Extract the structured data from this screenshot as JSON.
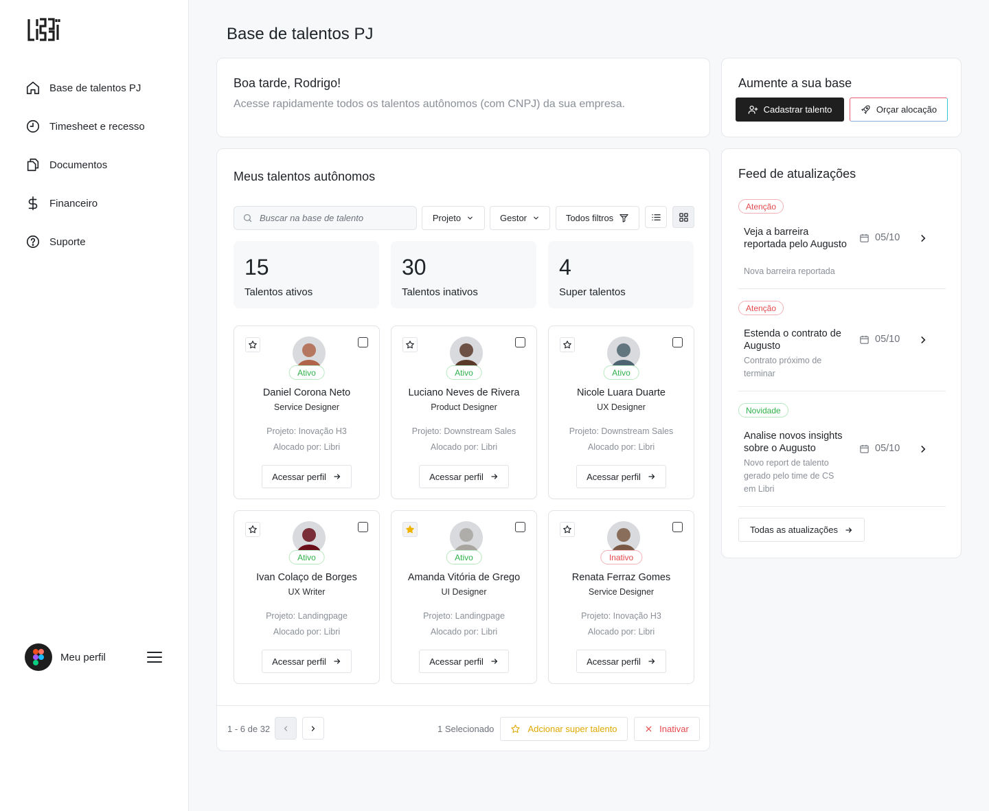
{
  "sidebar": {
    "logo_text": "LIBRI",
    "items": [
      {
        "label": "Base de talentos PJ",
        "icon": "home-icon"
      },
      {
        "label": "Timesheet e recesso",
        "icon": "clock-icon"
      },
      {
        "label": "Documentos",
        "icon": "documents-icon"
      },
      {
        "label": "Financeiro",
        "icon": "dollar-icon"
      },
      {
        "label": "Suporte",
        "icon": "help-circle-icon"
      }
    ],
    "profile_label": "Meu perfil"
  },
  "page_title": "Base de talentos PJ",
  "greeting": {
    "title": "Boa tarde, Rodrigo!",
    "subtitle": "Acesse rapidamente todos os talentos autônomos (com CNPJ) da sua empresa."
  },
  "grow": {
    "title": "Aumente a sua base",
    "primary_label": "Cadastrar talento",
    "secondary_label": "Orçar alocação"
  },
  "talents": {
    "title": "Meus talentos autônomos",
    "search_placeholder": "Buscar na base de talento",
    "filters": [
      "Projeto",
      "Gestor",
      "Todos filtros"
    ],
    "stats": [
      {
        "value": "15",
        "label": "Talentos ativos"
      },
      {
        "value": "30",
        "label": "Talentos inativos"
      },
      {
        "value": "4",
        "label": "Super talentos"
      }
    ],
    "cards": [
      {
        "name": "Daniel Corona Neto",
        "role": "Service Designer",
        "project": "Projeto: Inovação H3",
        "allocated": "Alocado por: Libri",
        "status": "Ativo",
        "starred": false,
        "button": "Acessar perfil",
        "avatar_color": "#b0654a"
      },
      {
        "name": "Luciano Neves de Rivera",
        "role": "Product Designer",
        "project": "Projeto: Downstream Sales",
        "allocated": "Alocado por: Libri",
        "status": "Ativo",
        "starred": false,
        "button": "Acessar perfil",
        "avatar_color": "#5a3a2a"
      },
      {
        "name": "Nicole Luara Duarte",
        "role": "UX Designer",
        "project": "Projeto: Downstream Sales",
        "allocated": "Alocado por: Libri",
        "status": "Ativo",
        "starred": false,
        "button": "Acessar perfil",
        "avatar_color": "#4e6470"
      },
      {
        "name": "Ivan Colaço de Borges",
        "role": "UX Writer",
        "project": "Projeto: Landingpage",
        "allocated": "Alocado por: Libri",
        "status": "Ativo",
        "starred": false,
        "button": "Acessar perfil",
        "avatar_color": "#6a0f1a"
      },
      {
        "name": "Amanda Vitória de Grego",
        "role": "UI Designer",
        "project": "Projeto: Landingpage",
        "allocated": "Alocado por: Libri",
        "status": "Ativo",
        "starred": true,
        "button": "Acessar perfil",
        "avatar_color": "#a8a4a0"
      },
      {
        "name": "Renata Ferraz Gomes",
        "role": "Service Designer",
        "project": "Projeto:  Inovação H3",
        "allocated": "Alocado por: Libri",
        "status": "Inativo",
        "starred": false,
        "button": "Acessar perfil",
        "avatar_color": "#7a5a44"
      }
    ],
    "pagination": "1 - 6 de 32",
    "selected": "1 Selecionado",
    "add_super_label": "Adcionar super talento",
    "inactivate_label": "Inativar"
  },
  "feed": {
    "title": "Feed de atualizações",
    "items": [
      {
        "tag": "Atenção",
        "title": "Veja a barreira reportada pelo Augusto",
        "sub": "Nova barreira reportada",
        "date": "05/10"
      },
      {
        "tag": "Atenção",
        "title": "Estenda o contrato de Augusto",
        "sub": "Contrato próximo de terminar",
        "date": "05/10"
      },
      {
        "tag": "Novidade",
        "title": "Analise novos insights sobre o Augusto",
        "sub": "Novo report de talento gerado pelo time de CS em Libri",
        "date": "05/10"
      }
    ],
    "all_label": "Todas as atualizações"
  },
  "colors": {
    "accent_dark": "#1f1f1f",
    "success": "#2eb14b",
    "danger": "#e5484d",
    "star": "#f0b400"
  }
}
